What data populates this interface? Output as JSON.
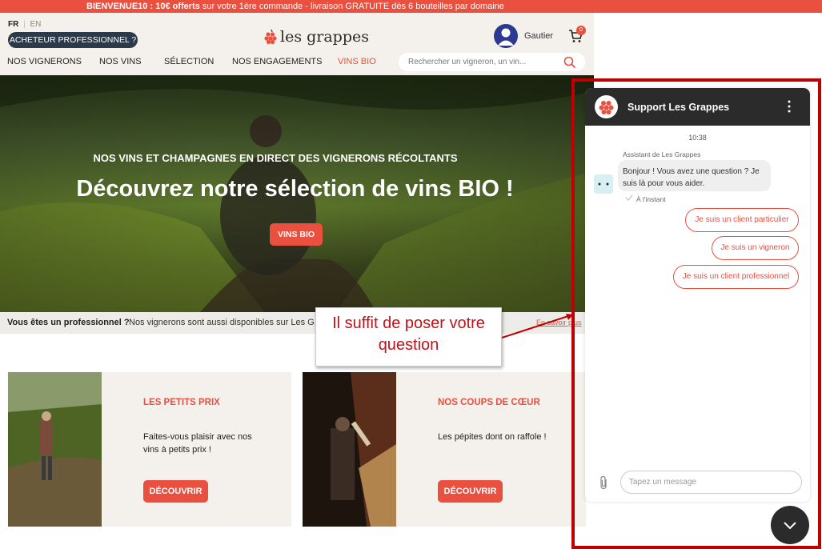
{
  "promo": {
    "code": "BIENVENUE10 :",
    "bold": "10€ offerts",
    "text": " sur votre 1ère commande - livraison GRATUITE dès 6 bouteilles par domaine"
  },
  "header": {
    "lang_fr": "FR",
    "lang_sep": "|",
    "lang_en": "EN",
    "pro_button": "ACHETEUR PROFESSIONNEL ?",
    "logo_text": "les grappes",
    "user_name": "Gautier",
    "cart_count": "0"
  },
  "nav": {
    "items": [
      "NOS VIGNERONS",
      "NOS VINS",
      "SÉLECTION",
      "NOS ENGAGEMENTS",
      "VINS BIO"
    ]
  },
  "search": {
    "placeholder": "Rechercher un vigneron, un vin..."
  },
  "hero": {
    "subtitle": "NOS VINS ET CHAMPAGNES EN DIRECT DES VIGNERONS RÉCOLTANTS",
    "title": "Découvrez notre sélection de vins BIO !",
    "button": "VINS BIO"
  },
  "pro_strip": {
    "question": "Vous êtes un professionnel ?",
    "text": "Nos vignerons sont aussi disponibles sur Les G",
    "link": "En savoir plus"
  },
  "cards": [
    {
      "title": "LES PETITS PRIX",
      "text": "Faites-vous plaisir avec nos vins à petits prix !",
      "button": "DÉCOUVRIR"
    },
    {
      "title": "NOS COUPS DE CŒUR",
      "text": "Les pépites dont on raffole !",
      "button": "DÉCOUVRIR"
    }
  ],
  "callout": {
    "line1": "Il suffit de poser votre",
    "line2": "question"
  },
  "chat": {
    "title": "Support Les Grappes",
    "time": "10:38",
    "sender": "Assistant de Les Grappes",
    "message": "Bonjour ! Vous avez une question ? Je suis là pour vous aider.",
    "status": "À l'instant",
    "options": [
      "Je suis un client particulier",
      "Je suis un vigneron",
      "Je suis un client professionnel"
    ],
    "input_placeholder": "Tapez un message"
  },
  "colors": {
    "accent": "#e9503f",
    "dark": "#2b2b2b",
    "annotation": "#c00000"
  }
}
